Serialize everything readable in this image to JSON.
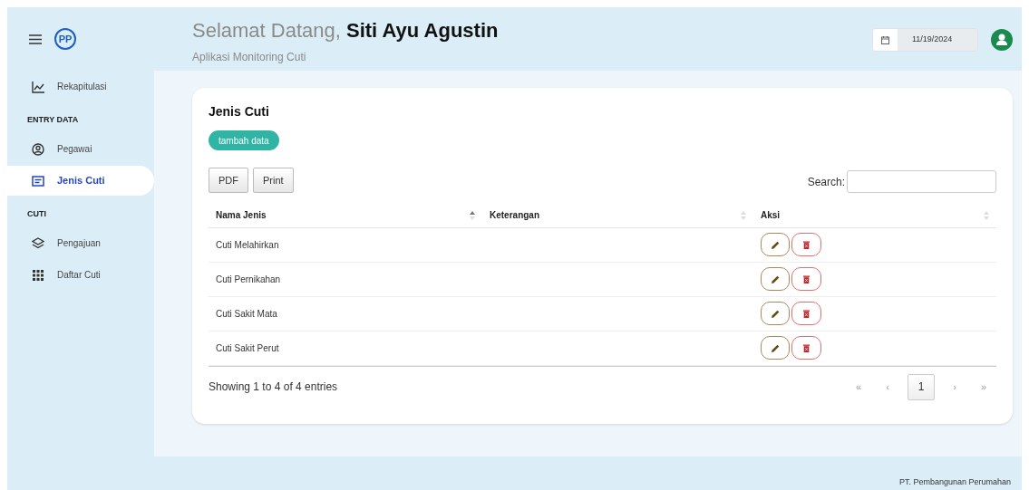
{
  "logo": {
    "text": "PP"
  },
  "header": {
    "greeting": "Selamat Datang,",
    "user": "Siti Ayu Agustin",
    "subtitle": "Aplikasi Monitoring Cuti",
    "date": "11/19/2024"
  },
  "sidebar": {
    "items": [
      {
        "kind": "link",
        "label": "Rekapitulasi",
        "selected": false
      },
      {
        "kind": "section",
        "label": "ENTRY DATA"
      },
      {
        "kind": "link",
        "label": "Pegawai",
        "selected": false
      },
      {
        "kind": "link",
        "label": "Jenis Cuti",
        "selected": true
      },
      {
        "kind": "section",
        "label": "CUTI"
      },
      {
        "kind": "link",
        "label": "Pengajuan",
        "selected": false
      },
      {
        "kind": "link",
        "label": "Daftar Cuti",
        "selected": false
      }
    ]
  },
  "card": {
    "title": "Jenis Cuti",
    "add_button": "tambah data",
    "export_buttons": [
      "PDF",
      "Print"
    ],
    "search_label": "Search:",
    "table": {
      "columns": [
        {
          "label": "Nama Jenis",
          "sorted": true
        },
        {
          "label": "Keterangan",
          "sorted": false
        },
        {
          "label": "Aksi",
          "sorted": false
        }
      ],
      "rows": [
        {
          "name": "Cuti Melahirkan"
        },
        {
          "name": "Cuti Pernikahan"
        },
        {
          "name": "Cuti Sakit Mata"
        },
        {
          "name": "Cuti Sakit Perut"
        }
      ]
    },
    "info": "Showing 1 to 4 of 4 entries",
    "pagination": [
      {
        "label": "«",
        "selected": false
      },
      {
        "label": "‹",
        "selected": false
      },
      {
        "label": "1",
        "selected": true
      },
      {
        "label": "›",
        "selected": false
      },
      {
        "label": "»",
        "selected": false
      }
    ]
  },
  "footer": "PT. Pembangunan Perumahan"
}
